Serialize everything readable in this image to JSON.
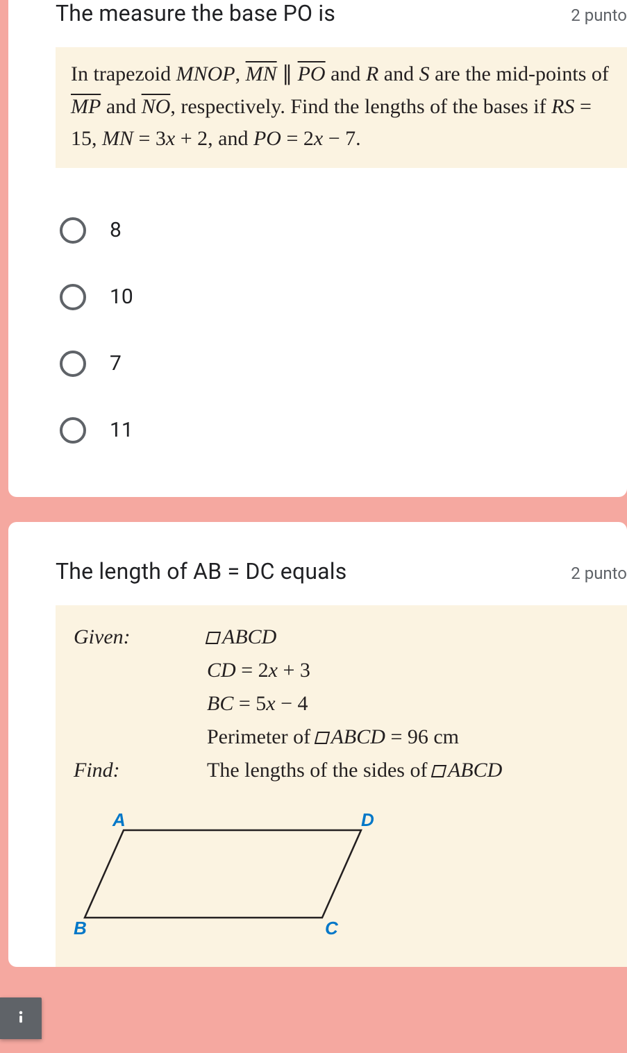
{
  "q1": {
    "title": "The measure the base PO is",
    "points": "2 punto",
    "problem_parts": {
      "p1": "In trapezoid ",
      "mnop": "MNOP",
      "p2": ", ",
      "mn": "MN",
      "p3": " ∥ ",
      "po": "PO",
      "p4": " and ",
      "r": "R",
      "p5": " and ",
      "s": "S",
      "p6": " are the mid-points of ",
      "mp": "MP",
      "p7": " and ",
      "no": "NO",
      "p8": ", respectively. Find the lengths of the bases if ",
      "rs": "RS",
      "eq1": "  =  15, ",
      "mn2": "MN",
      "eq2": "  =  3",
      "x1": "x",
      "eq3": "  +  2, and ",
      "po2": "PO",
      "eq4": "  =  2",
      "x2": "x",
      "eq5": "  −  7."
    },
    "options": [
      "8",
      "10",
      "7",
      "11"
    ]
  },
  "q2": {
    "title": "The length of AB = DC equals",
    "points": "2 punto",
    "given_label": "Given:",
    "find_label": "Find:",
    "abcd": "ABCD",
    "line_cd_a": "CD",
    "line_cd_b": "  =  2",
    "line_cd_x": "x",
    "line_cd_c": "  +  3",
    "line_bc_a": "BC",
    "line_bc_b": "  =  5",
    "line_bc_x": "x",
    "line_bc_c": "  −  4",
    "perim_a": "Perimeter of ",
    "perim_b": "  =  96 cm",
    "find_text": "The lengths of the sides of ",
    "vA": "A",
    "vB": "B",
    "vC": "C",
    "vD": "D"
  },
  "icons": {
    "report": "report-problem-icon"
  }
}
